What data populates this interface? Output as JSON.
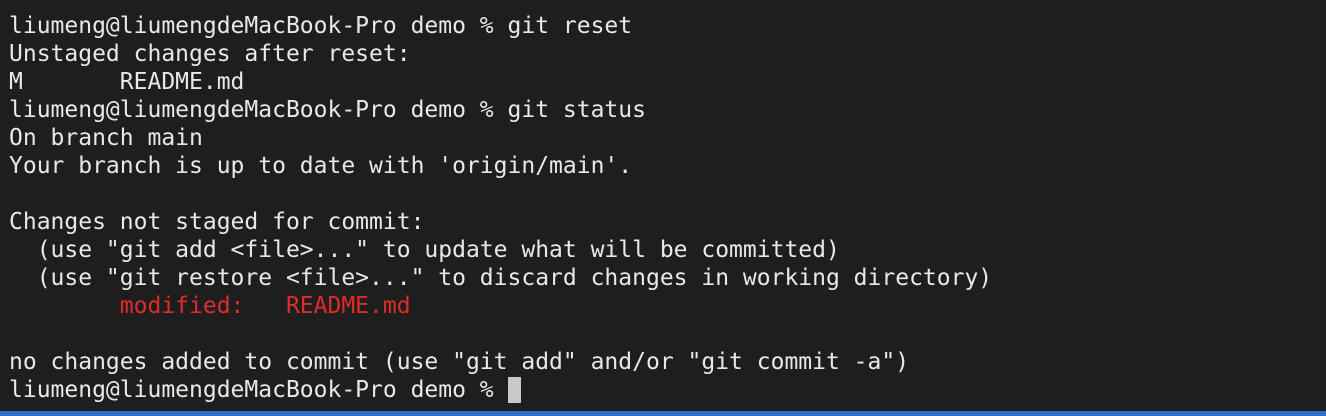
{
  "terminal": {
    "lines": [
      "liumeng@liumengdeMacBook-Pro demo % git reset",
      "Unstaged changes after reset:",
      "M       README.md",
      "liumeng@liumengdeMacBook-Pro demo % git status",
      "On branch main",
      "Your branch is up to date with 'origin/main'.",
      "",
      "Changes not staged for commit:",
      "  (use \"git add <file>...\" to update what will be committed)",
      "  (use \"git restore <file>...\" to discard changes in working directory)",
      "        modified:   README.md",
      "",
      "no changes added to commit (use \"git add\" and/or \"git commit -a\")"
    ],
    "prompt": "liumeng@liumengdeMacBook-Pro demo % "
  },
  "colors": {
    "background": "#1e1e1e",
    "text": "#e8e8e8",
    "modified": "#e02b2b",
    "cursor": "#c8c8c8",
    "border_accent": "#2d73c9"
  }
}
